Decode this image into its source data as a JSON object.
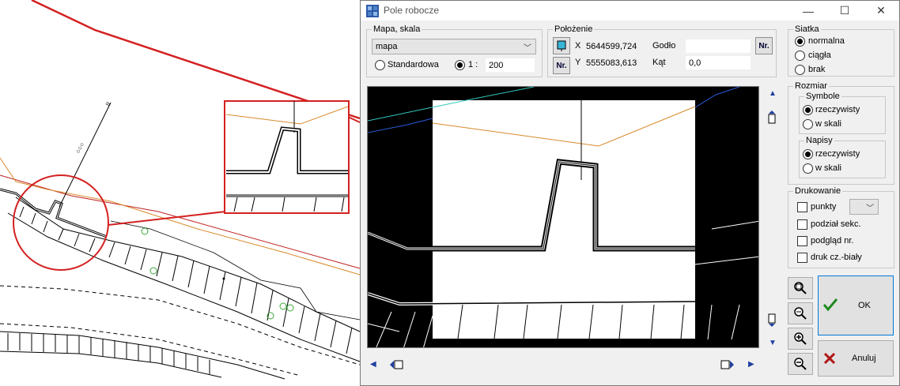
{
  "window": {
    "title": "Pole robocze",
    "minimize": "—",
    "maximize": "☐",
    "close": "✕"
  },
  "map_scale": {
    "legend": "Mapa, skala",
    "map_select": "mapa",
    "radio_standard": "Standardowa",
    "radio_one": "1 :",
    "scale_value": "200"
  },
  "position": {
    "legend": "Położenie",
    "x_label": "X",
    "x_value": "5644599,724",
    "y_label": "Y",
    "y_value": "5555083,613",
    "godlo_label": "Godło",
    "godlo_value": "",
    "kat_label": "Kąt",
    "kat_value": "0,0",
    "nr_label": "Nr."
  },
  "grid": {
    "legend": "Siatka",
    "options": [
      "normalna",
      "ciągła",
      "brak"
    ],
    "selected": 0
  },
  "size": {
    "legend": "Rozmiar",
    "symbols": {
      "legend": "Symbole",
      "options": [
        "rzeczywisty",
        "w skali"
      ],
      "selected": 0
    },
    "labels": {
      "legend": "Napisy",
      "options": [
        "rzeczywisty",
        "w skali"
      ],
      "selected": 0
    }
  },
  "printing": {
    "legend": "Drukowanie",
    "items": [
      "punkty",
      "podział sekc.",
      "podgląd nr.",
      "druk cz.-biały"
    ]
  },
  "buttons": {
    "ok": "OK",
    "cancel": "Anuluj"
  },
  "icons": {
    "zoom": "magnifier-icon",
    "ok": "checkmark-icon",
    "cancel": "cross-icon"
  },
  "colors": {
    "red_line": "#d42020",
    "orange_line": "#d98a2b",
    "blue_line": "#2a5bd8",
    "cyan_line": "#33c8c0",
    "green_marker": "#3aa83a",
    "ok_check": "#1e8a1e",
    "cancel_cross": "#b01818"
  }
}
